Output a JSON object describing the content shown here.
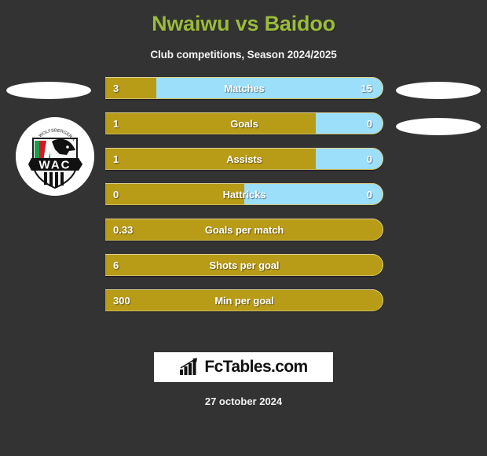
{
  "header": {
    "title": "Nwaiwu vs Baidoo",
    "subtitle": "Club competitions, Season 2024/2025",
    "title_color": "#9BBB3B"
  },
  "colors": {
    "background": "#333333",
    "home_bar": "#B89B16",
    "away_bar": "#9BDFFA",
    "text": "#FFFFFF"
  },
  "crest": {
    "name": "Wolfsberger AC",
    "abbr": "WAC"
  },
  "chart_data": {
    "type": "bar",
    "title": "Nwaiwu vs Baidoo",
    "subtitle": "Club competitions, Season 2024/2025",
    "orientation": "horizontal",
    "legend": [
      "Nwaiwu",
      "Baidoo"
    ],
    "categories": [
      "Matches",
      "Goals",
      "Assists",
      "Hattricks",
      "Goals per match",
      "Shots per goal",
      "Min per goal"
    ],
    "series": [
      {
        "name": "Nwaiwu",
        "values": [
          "3",
          "1",
          "1",
          "0",
          "0.33",
          "6",
          "300"
        ]
      },
      {
        "name": "Baidoo",
        "values": [
          "15",
          "0",
          "0",
          "0",
          null,
          null,
          null
        ]
      }
    ],
    "rows": [
      {
        "label": "Matches",
        "home": "3",
        "away": "15",
        "home_pct": 18.4,
        "split": true
      },
      {
        "label": "Goals",
        "home": "1",
        "away": "0",
        "home_pct": 76.0,
        "split": true
      },
      {
        "label": "Assists",
        "home": "1",
        "away": "0",
        "home_pct": 76.0,
        "split": true
      },
      {
        "label": "Hattricks",
        "home": "0",
        "away": "0",
        "home_pct": 50.0,
        "split": true
      },
      {
        "label": "Goals per match",
        "home": "0.33",
        "away": "",
        "home_pct": 100,
        "split": false
      },
      {
        "label": "Shots per goal",
        "home": "6",
        "away": "",
        "home_pct": 100,
        "split": false
      },
      {
        "label": "Min per goal",
        "home": "300",
        "away": "",
        "home_pct": 100,
        "split": false
      }
    ]
  },
  "footer": {
    "brand": "FcTables.com",
    "date": "27 october 2024"
  }
}
